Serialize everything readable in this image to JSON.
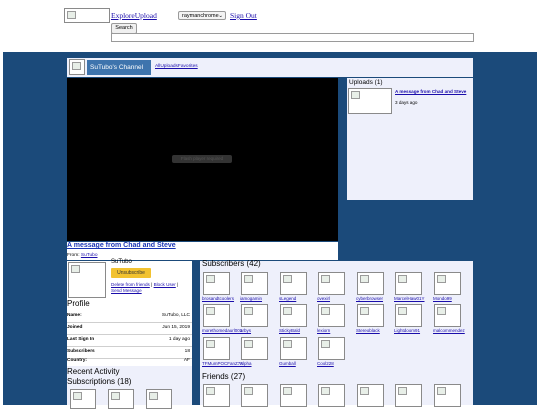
{
  "header": {
    "explore_upload": "ExploreUpload",
    "user_select": "raymanchrome",
    "sign_out": "Sign Out",
    "search_button": "Search"
  },
  "channel": {
    "title": "SuTubo's Channel",
    "tabs": "AllUploadsFavorites",
    "video_title": "A message from Chad and Steve",
    "from_label": "From:",
    "from_user": "SuTubo",
    "player_error": "Flash player required"
  },
  "uploads": {
    "heading": "Uploads (1)",
    "items": [
      {
        "title": "A message from Chad and Steve",
        "age": "3 days ago"
      }
    ]
  },
  "owner": {
    "name": "SuTubo",
    "unsubscribe": "Unsubscribe",
    "delete_friends": "Delete from friends",
    "block_user": "Block User",
    "send_message": "Send Message"
  },
  "profile": {
    "heading": "Profile",
    "rows": [
      {
        "key": "Name:",
        "value": "SuTubo, LLC"
      },
      {
        "key": "Joined",
        "value": "Jun 15, 2019"
      },
      {
        "key": "Last Sign In",
        "value": "1 day ago"
      },
      {
        "key": "Subscribers",
        "value": "18"
      },
      {
        "key": "Country:",
        "value": "AF"
      }
    ]
  },
  "activity": {
    "heading": "Recent Activity"
  },
  "subscriptions": {
    "heading": "Subscriptions (18)"
  },
  "subscribers": {
    "heading": "Subscribers (42)",
    "names": [
      "brosandtcoolers",
      "iamogamin",
      "sLegend",
      "ovexirl",
      "cyberbrowser",
      "MarcelHaw01Y",
      "Mondo99",
      "morethomedaurl001",
      "arbys",
      "StickyBald",
      "lexiorn",
      "Stereoblack",
      "Lightdoom91",
      "malcommendez",
      "TFMumPOCFanZ78",
      "Alpha",
      "Gumball",
      "Cool228"
    ]
  },
  "friends": {
    "heading": "Friends (27)"
  }
}
